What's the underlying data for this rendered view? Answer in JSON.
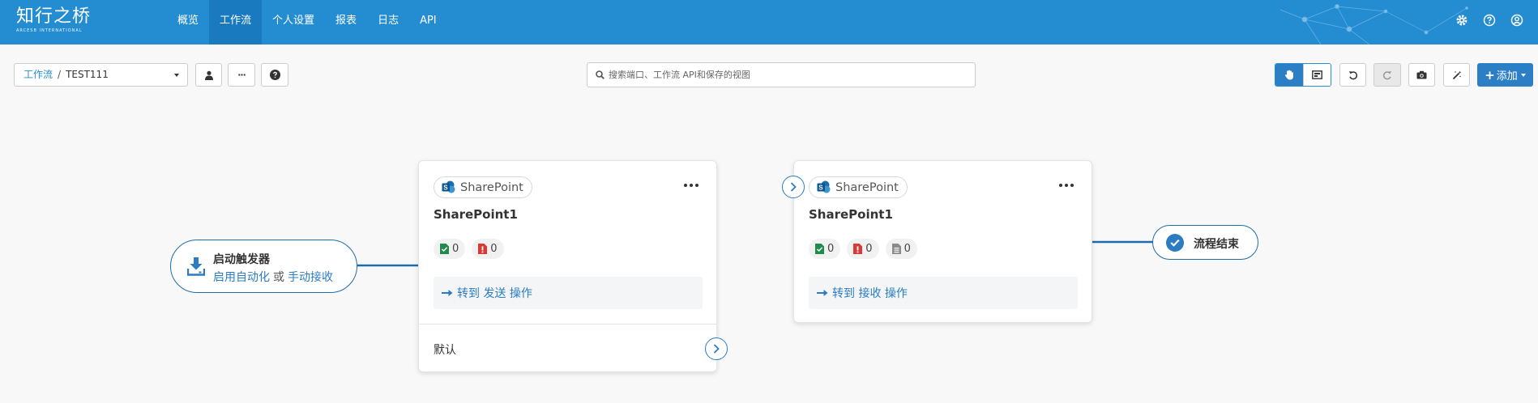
{
  "header": {
    "logo_cn": "知行之桥",
    "logo_en": "ARCESB INTERNATIONAL",
    "nav": [
      {
        "label": "概览"
      },
      {
        "label": "工作流",
        "active": true
      },
      {
        "label": "个人设置"
      },
      {
        "label": "报表"
      },
      {
        "label": "日志"
      },
      {
        "label": "API"
      }
    ],
    "accent": "#248dd2"
  },
  "toolbar": {
    "breadcrumb_root": "工作流",
    "breadcrumb_sep": "/",
    "breadcrumb_current": "TEST111",
    "more_label": "···",
    "search_placeholder": "搜索端口、工作流 API和保存的视图",
    "add_label": "添加"
  },
  "flow": {
    "trigger": {
      "title": "启动触发器",
      "link1": "启用自动化",
      "or": "或",
      "link2": "手动接收"
    },
    "cards": [
      {
        "type": "SharePoint",
        "title": "SharePoint1",
        "stats": [
          "0",
          "0"
        ],
        "goto_prefix": "转到",
        "goto_link": "发送",
        "goto_suffix": "操作",
        "default_label": "默认"
      },
      {
        "type": "SharePoint",
        "title": "SharePoint1",
        "stats": [
          "0",
          "0",
          "0"
        ],
        "goto_prefix": "转到",
        "goto_link": "接收",
        "goto_suffix": "操作"
      }
    ],
    "end": {
      "label": "流程结束"
    },
    "line_color": "#1f6da8"
  }
}
